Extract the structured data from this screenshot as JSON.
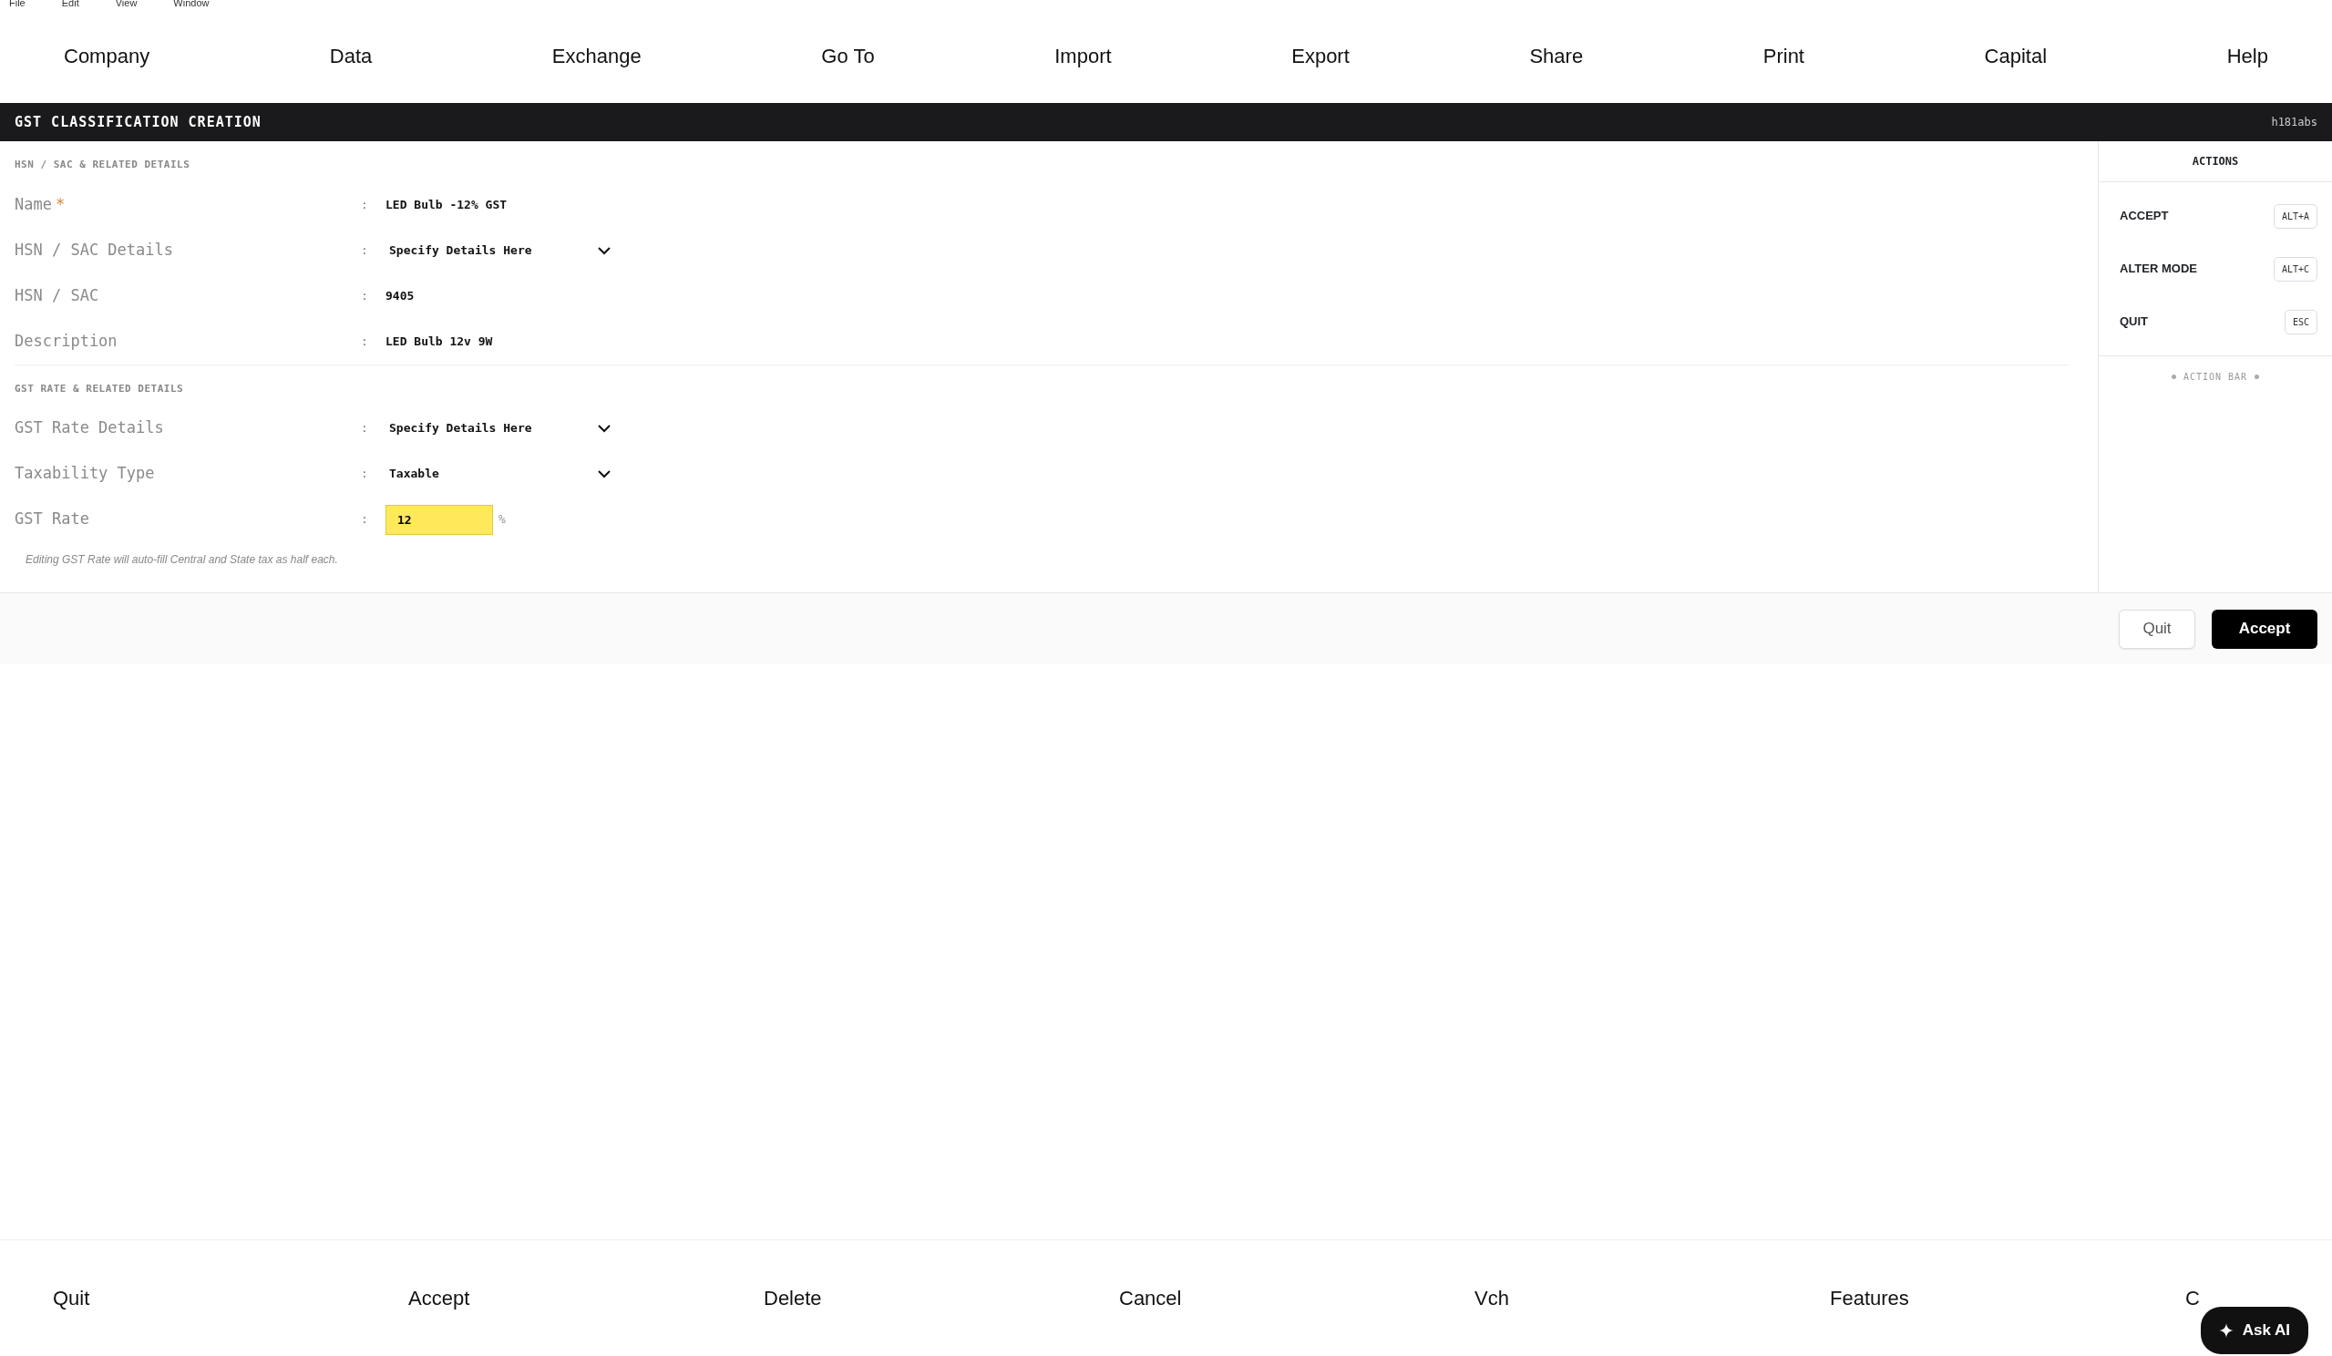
{
  "app_menu": [
    "File",
    "Edit",
    "View",
    "Window"
  ],
  "menu": [
    "Company",
    "Data",
    "Exchange",
    "Go To",
    "Import",
    "Export",
    "Share",
    "Print",
    "Capital",
    "Help"
  ],
  "title_bar": {
    "title": "GST CLASSIFICATION CREATION",
    "brand": "h181abs"
  },
  "sections": [
    {
      "heading": "HSN / SAC & RELATED DETAILS",
      "fields": [
        {
          "label": "Name",
          "required_mark": "*",
          "colon": ":",
          "kind": "text",
          "value": "LED Bulb -12% GST"
        },
        {
          "label": "HSN / SAC Details",
          "colon": ":",
          "kind": "dropdown",
          "value": "Specify Details Here"
        },
        {
          "label": "HSN / SAC",
          "colon": ":",
          "kind": "text",
          "value": "9405"
        },
        {
          "label": "Description",
          "colon": ":",
          "kind": "text",
          "value": "LED Bulb 12v 9W"
        }
      ]
    },
    {
      "heading": "GST RATE & RELATED DETAILS",
      "fields": [
        {
          "label": "GST Rate Details",
          "colon": ":",
          "kind": "dropdown",
          "value": "Specify Details Here"
        },
        {
          "label": "Taxability Type",
          "colon": ":",
          "kind": "dropdown",
          "value": "Taxable"
        },
        {
          "label": "GST Rate",
          "colon": ":",
          "kind": "input",
          "value": "12",
          "suffix": "%"
        }
      ]
    }
  ],
  "note": "Editing GST Rate will auto-fill Central and State tax as half each.",
  "actions_panel": {
    "title": "ACTIONS",
    "items": [
      {
        "label": "ACCEPT",
        "shortcut": "ALT+A"
      },
      {
        "label": "ALTER MODE",
        "shortcut": "ALT+C"
      },
      {
        "label": "QUIT",
        "shortcut": "ESC"
      }
    ],
    "footer": "ACTION BAR"
  },
  "form_buttons": [
    {
      "label": "Quit",
      "kind": "secondary"
    },
    {
      "label": "Accept",
      "kind": "primary"
    }
  ],
  "bottom_bar": [
    "Quit",
    "Accept",
    "Delete",
    "Cancel",
    "Vch",
    "Features",
    "C"
  ],
  "ask_ai": {
    "label": "Ask AI"
  }
}
